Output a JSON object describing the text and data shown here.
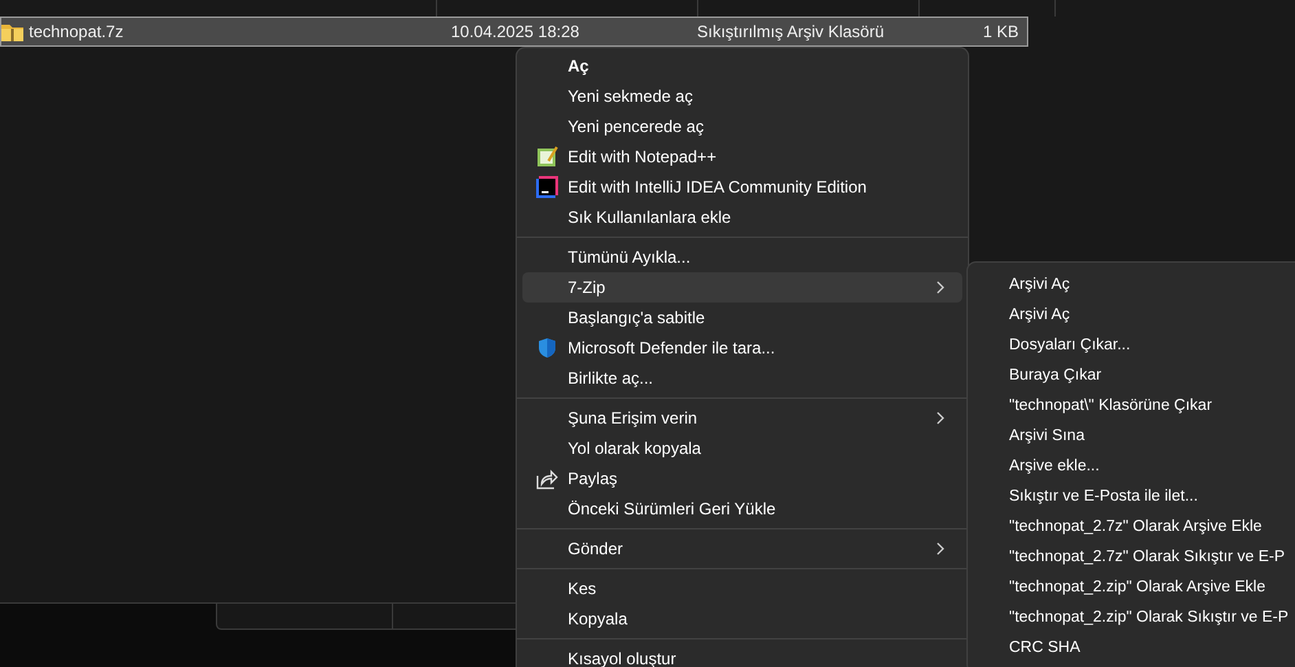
{
  "file_list": {
    "rows": [
      {
        "name": "technopat.7z",
        "date": "10.04.2025 18:28",
        "type": "Sıkıştırılmış Arşiv Klasörü",
        "size": "1 KB",
        "selected": true
      }
    ]
  },
  "context_menu": {
    "groups": [
      [
        {
          "label": "Aç",
          "bold": true,
          "submenu": false,
          "selected": false
        },
        {
          "label": "Yeni sekmede aç",
          "bold": false,
          "submenu": false,
          "selected": false
        },
        {
          "label": "Yeni pencerede aç",
          "bold": false,
          "submenu": false,
          "selected": false
        },
        {
          "label": "Edit with Notepad++",
          "bold": false,
          "submenu": false,
          "selected": false
        },
        {
          "label": "Edit with IntelliJ IDEA Community Edition",
          "bold": false,
          "submenu": false,
          "selected": false
        },
        {
          "label": "Sık Kullanılanlara ekle",
          "bold": false,
          "submenu": false,
          "selected": false
        }
      ],
      [
        {
          "label": "Tümünü Ayıkla...",
          "bold": false,
          "submenu": false,
          "selected": false
        },
        {
          "label": "7-Zip",
          "bold": false,
          "submenu": true,
          "selected": true
        },
        {
          "label": "Başlangıç'a sabitle",
          "bold": false,
          "submenu": false,
          "selected": false
        },
        {
          "label": "Microsoft Defender ile tara...",
          "bold": false,
          "submenu": false,
          "selected": false
        },
        {
          "label": "Birlikte aç...",
          "bold": false,
          "submenu": false,
          "selected": false
        }
      ],
      [
        {
          "label": "Şuna Erişim verin",
          "bold": false,
          "submenu": true,
          "selected": false
        },
        {
          "label": "Yol olarak kopyala",
          "bold": false,
          "submenu": false,
          "selected": false
        },
        {
          "label": "Paylaş",
          "bold": false,
          "submenu": false,
          "selected": false
        },
        {
          "label": "Önceki Sürümleri Geri Yükle",
          "bold": false,
          "submenu": false,
          "selected": false
        }
      ],
      [
        {
          "label": "Gönder",
          "bold": false,
          "submenu": true,
          "selected": false
        }
      ],
      [
        {
          "label": "Kes",
          "bold": false,
          "submenu": false,
          "selected": false
        },
        {
          "label": "Kopyala",
          "bold": false,
          "submenu": false,
          "selected": false
        }
      ],
      [
        {
          "label": "Kısayol oluştur",
          "bold": false,
          "submenu": false,
          "selected": false
        }
      ]
    ]
  },
  "submenu": {
    "items": [
      "Arşivi Aç",
      "Arşivi Aç",
      "Dosyaları Çıkar...",
      "Buraya Çıkar",
      "\"technopat\\\" Klasörüne Çıkar",
      "Arşivi Sına",
      "Arşive ekle...",
      "Sıkıştır ve E-Posta ile ilet...",
      "\"technopat_2.7z\" Olarak Arşive Ekle",
      "\"technopat_2.7z\" Olarak Sıkıştır ve E-P",
      "\"technopat_2.zip\" Olarak Arşive Ekle",
      "\"technopat_2.zip\" Olarak Sıkıştır ve E-P",
      "CRC SHA"
    ]
  }
}
